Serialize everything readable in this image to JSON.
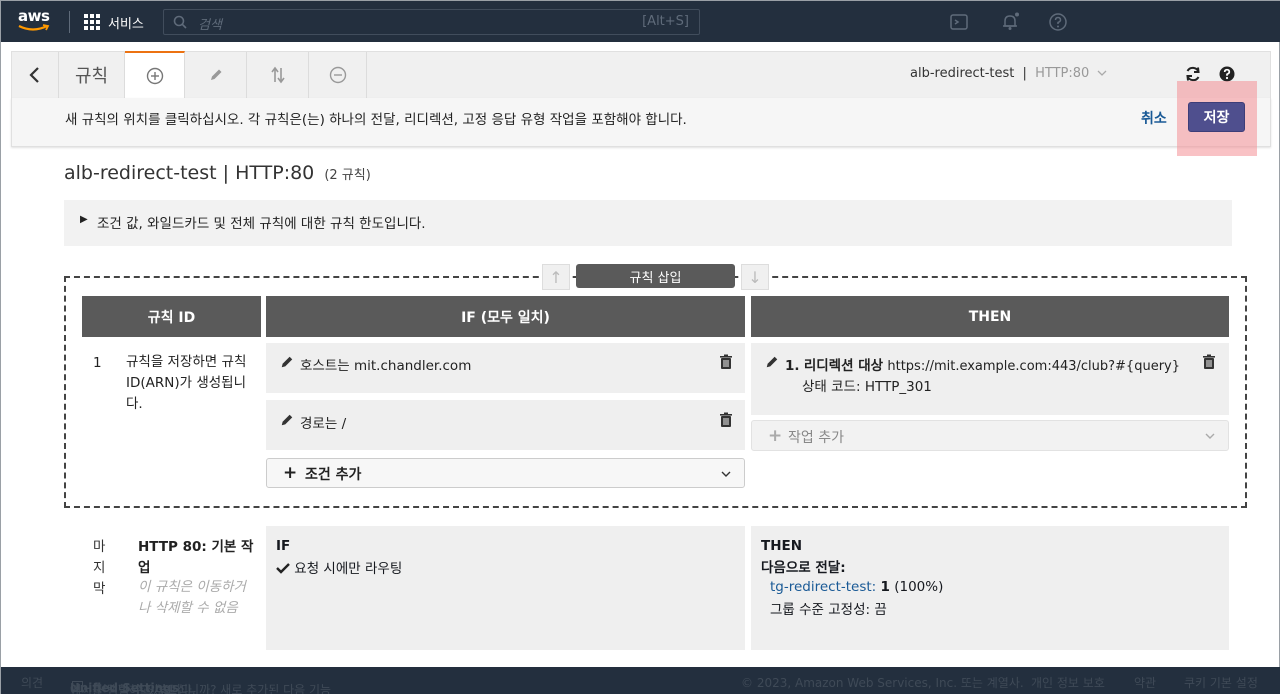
{
  "topnav": {
    "logo_text": "aws",
    "services_label": "서비스",
    "search_placeholder": "검색",
    "search_shortcut": "[Alt+S]",
    "icons": [
      "cloudshell-icon",
      "bell-icon",
      "help-icon"
    ]
  },
  "tabbar": {
    "back_icon": "chevron-left-icon",
    "title": "규칙",
    "tabs": [
      "plus-circle-icon",
      "pencil-icon",
      "sort-arrows-icon",
      "minus-circle-icon"
    ],
    "lb_name": "alb-redirect-test",
    "separator": "|",
    "listener": "HTTP:80",
    "refresh_icon": "refresh-icon",
    "help_icon": "help-icon"
  },
  "infobar": {
    "message": "새 규칙의 위치를 클릭하십시오. 각 규칙은(는) 하나의 전달, 리디렉션, 고정 응답 유형 작업을 포함해야 합니다.",
    "cancel_label": "취소",
    "save_label": "저장"
  },
  "page": {
    "title": "alb-redirect-test | HTTP:80",
    "rule_count": "(2 규칙)",
    "limits_text": "조건 값, 와일드카드 및 전체 규칙에 대한 규칙 한도입니다."
  },
  "new_rule": {
    "insert_label": "규칙 삽입",
    "headers": {
      "id": "규칙 ID",
      "if": "IF (모두 일치)",
      "then": "THEN"
    },
    "id": "1",
    "id_note": "규칙을 저장하면 규칙 ID(ARN)가 생성됩니다.",
    "conditions": [
      {
        "label": "호스트는",
        "value": "mit.chandler.com"
      },
      {
        "label": "경로는",
        "value": "/"
      }
    ],
    "add_condition_label": "조건 추가",
    "action": {
      "index": "1.",
      "type": "리디렉션 대상",
      "url": "https://mit.example.com:443/club?#{query}",
      "status_label": "상태 코드:",
      "status_value": "HTTP_301"
    },
    "add_action_label": "작업 추가"
  },
  "default_rule": {
    "position_label": "마지막",
    "name": "HTTP 80: 기본 작업",
    "note": "이 규칙은 이동하거나 삭제할 수 없음",
    "if_label": "IF",
    "if_condition": "요청 시에만 라우팅",
    "then_label": "THEN",
    "forward_label": "다음으로 전달:",
    "target_group": "tg-redirect-test:",
    "weight": "1",
    "weight_pct": "(100%)",
    "stickiness": "그룹 수준 고정성: 끔"
  },
  "footer": {
    "feedback": "의견",
    "notice": "언어를 선택하고 싶으십니까? 새로 추가된 다음 기능",
    "unified": "Unified Settings",
    "notice2": "에서 선택할 수 있습니다.",
    "copyright": "© 2023, Amazon Web Services, Inc. 또는 계열사.",
    "privacy": "개인 정보 보호",
    "terms": "약관",
    "cookies": "쿠키 기본 설정"
  }
}
